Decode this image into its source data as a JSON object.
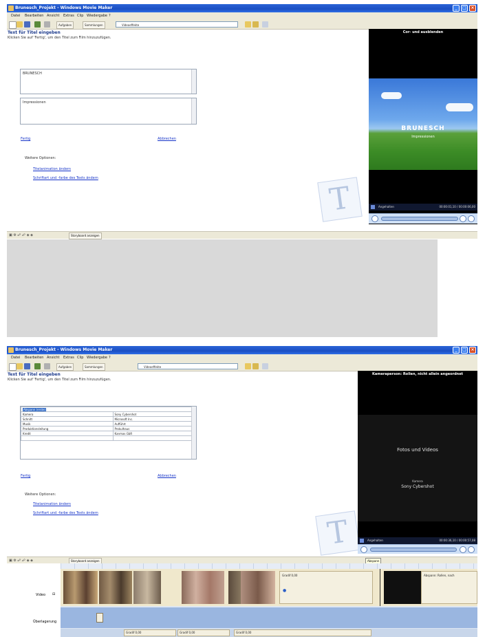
{
  "window1": {
    "title": "Brunesch_Projekt - Windows Movie Maker",
    "menu": [
      "Datei",
      "Bearbeiten",
      "Ansicht",
      "Extras",
      "Clip",
      "Wiedergabe",
      "?"
    ],
    "toolbar": {
      "tasks": "Aufgaben",
      "collections": "Sammlungen",
      "collection_combo": "Videoeffekte"
    },
    "heading": "Text für Titel eingeben",
    "subheading": "Klicken Sie auf 'Fertig', um den Titel zum Film hinzuzufügen.",
    "textbox1": "BRUNESCH",
    "textbox2": "Impressionen",
    "link_done": "Fertig",
    "link_cancel": "Abbrechen",
    "more_options": "Weitere Optionen:",
    "link_animation": "Titelanimation ändern",
    "link_font_color": "Schriftart und -farbe des Texts ändern",
    "preview": {
      "title": "Cor- und ausblenden",
      "line1": "BRUNESCH",
      "line2": "Impressionen",
      "status": "Angehalten",
      "time": "00:00:01,10 / 00:00:06,00"
    },
    "status_tool": "Storyboard anzeigen"
  },
  "window2": {
    "title": "Brunesch_Projekt - Windows Movie Maker",
    "menu": [
      "Datei",
      "Bearbeiten",
      "Ansicht",
      "Extras",
      "Clip",
      "Wiedergabe",
      "?"
    ],
    "toolbar": {
      "tasks": "Aufgaben",
      "collections": "Sammlungen",
      "collection_combo": "Videoeffekte"
    },
    "heading": "Text für Titel eingeben",
    "subheading": "Klicken Sie auf 'Fertig', um den Titel zum Film hinzuzufügen.",
    "grid_header": "Abspann (erste)",
    "grid_rows": [
      [
        "Kamera",
        "Sony Cybershot"
      ],
      [
        "Schnitt",
        "Microsoft Inc."
      ],
      [
        "Musik",
        "Aufführt"
      ],
      [
        "Produktionsleitung",
        "Prokulhaus"
      ],
      [
        "Kredit",
        "Kanmas GbR"
      ]
    ],
    "link_done": "Fertig",
    "link_cancel": "Abbrechen",
    "more_options": "Weitere Optionen:",
    "link_animation": "Titelanimation ändern",
    "link_font_color": "Schriftart und -farbe des Texts ändern",
    "preview": {
      "title": "Kameraperson: Rollen, nicht allein angeordnet",
      "line1": "Fotos und Videos",
      "line2_small": "Kamera",
      "line3": "Sony Cybershot",
      "status": "Angehalten",
      "time": "00:00:36,10 / 00:00:57,08"
    },
    "status_tool": "Storyboard anzeigen",
    "timeline_tooltip": "Abspann"
  },
  "timeline": {
    "video_label": "Video",
    "overlay_label": "Überlagerung",
    "title_text_cell": "Abspann: Rollen, nach",
    "small_cell": "Gradif 0,00",
    "audio_cells": [
      "Gradif 0,00",
      "Gradif 0,00",
      "Gradif 0,00"
    ]
  },
  "colors": {
    "xp_blue": "#1b4fc3",
    "menu_bg": "#ece9d8",
    "link": "#1533c8",
    "heading": "#1c3a8c"
  }
}
